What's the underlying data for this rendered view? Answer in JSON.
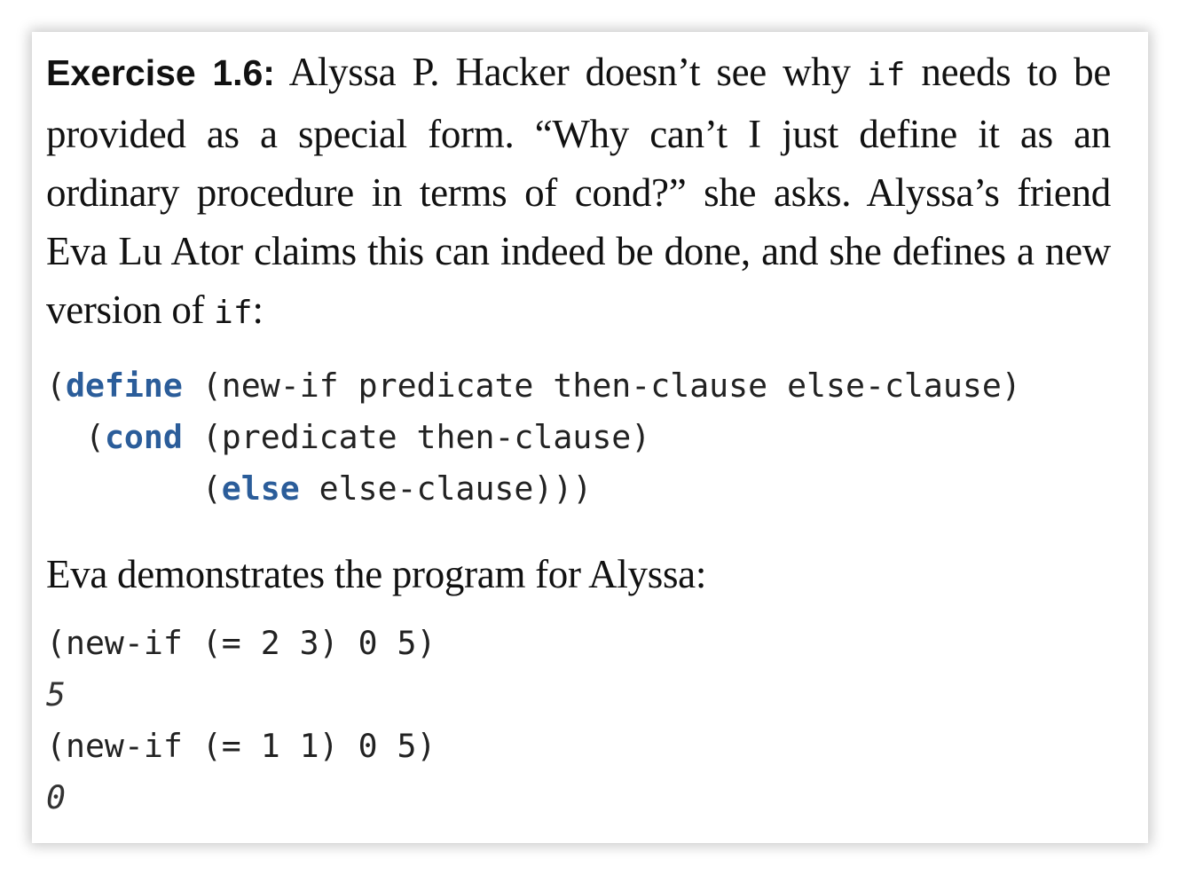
{
  "exercise": {
    "label": "Exercise 1.6:",
    "text_1": " Alyssa P. Hacker doesn’t see why ",
    "code_if_1": "if",
    "text_2": " needs to be provided as a special form. “Why can’t I just define it as an ordinary procedure in terms of ",
    "text_cond": "cond",
    "text_3": "?” she asks. Alyssa’s friend Eva Lu Ator claims this can indeed be done, and she defines a new version of ",
    "code_if_2": "if",
    "text_4": ":"
  },
  "code_block_1": {
    "line1": {
      "open": "(",
      "keyword": "define",
      "rest": " (new-if predicate then-clause else-clause)"
    },
    "line2": {
      "indent": "  (",
      "keyword": "cond",
      "rest": " (predicate then-clause)"
    },
    "line3": {
      "indent": "        (",
      "keyword": "else",
      "rest": " else-clause)))"
    }
  },
  "demo_paragraph": "Eva demonstrates the program for Alyssa:",
  "code_block_2": {
    "call_1": "(new-if (= 2 3) 0 5)",
    "result_1": "5",
    "call_2": "(new-if (= 1 1) 0 5)",
    "result_2": "0"
  }
}
